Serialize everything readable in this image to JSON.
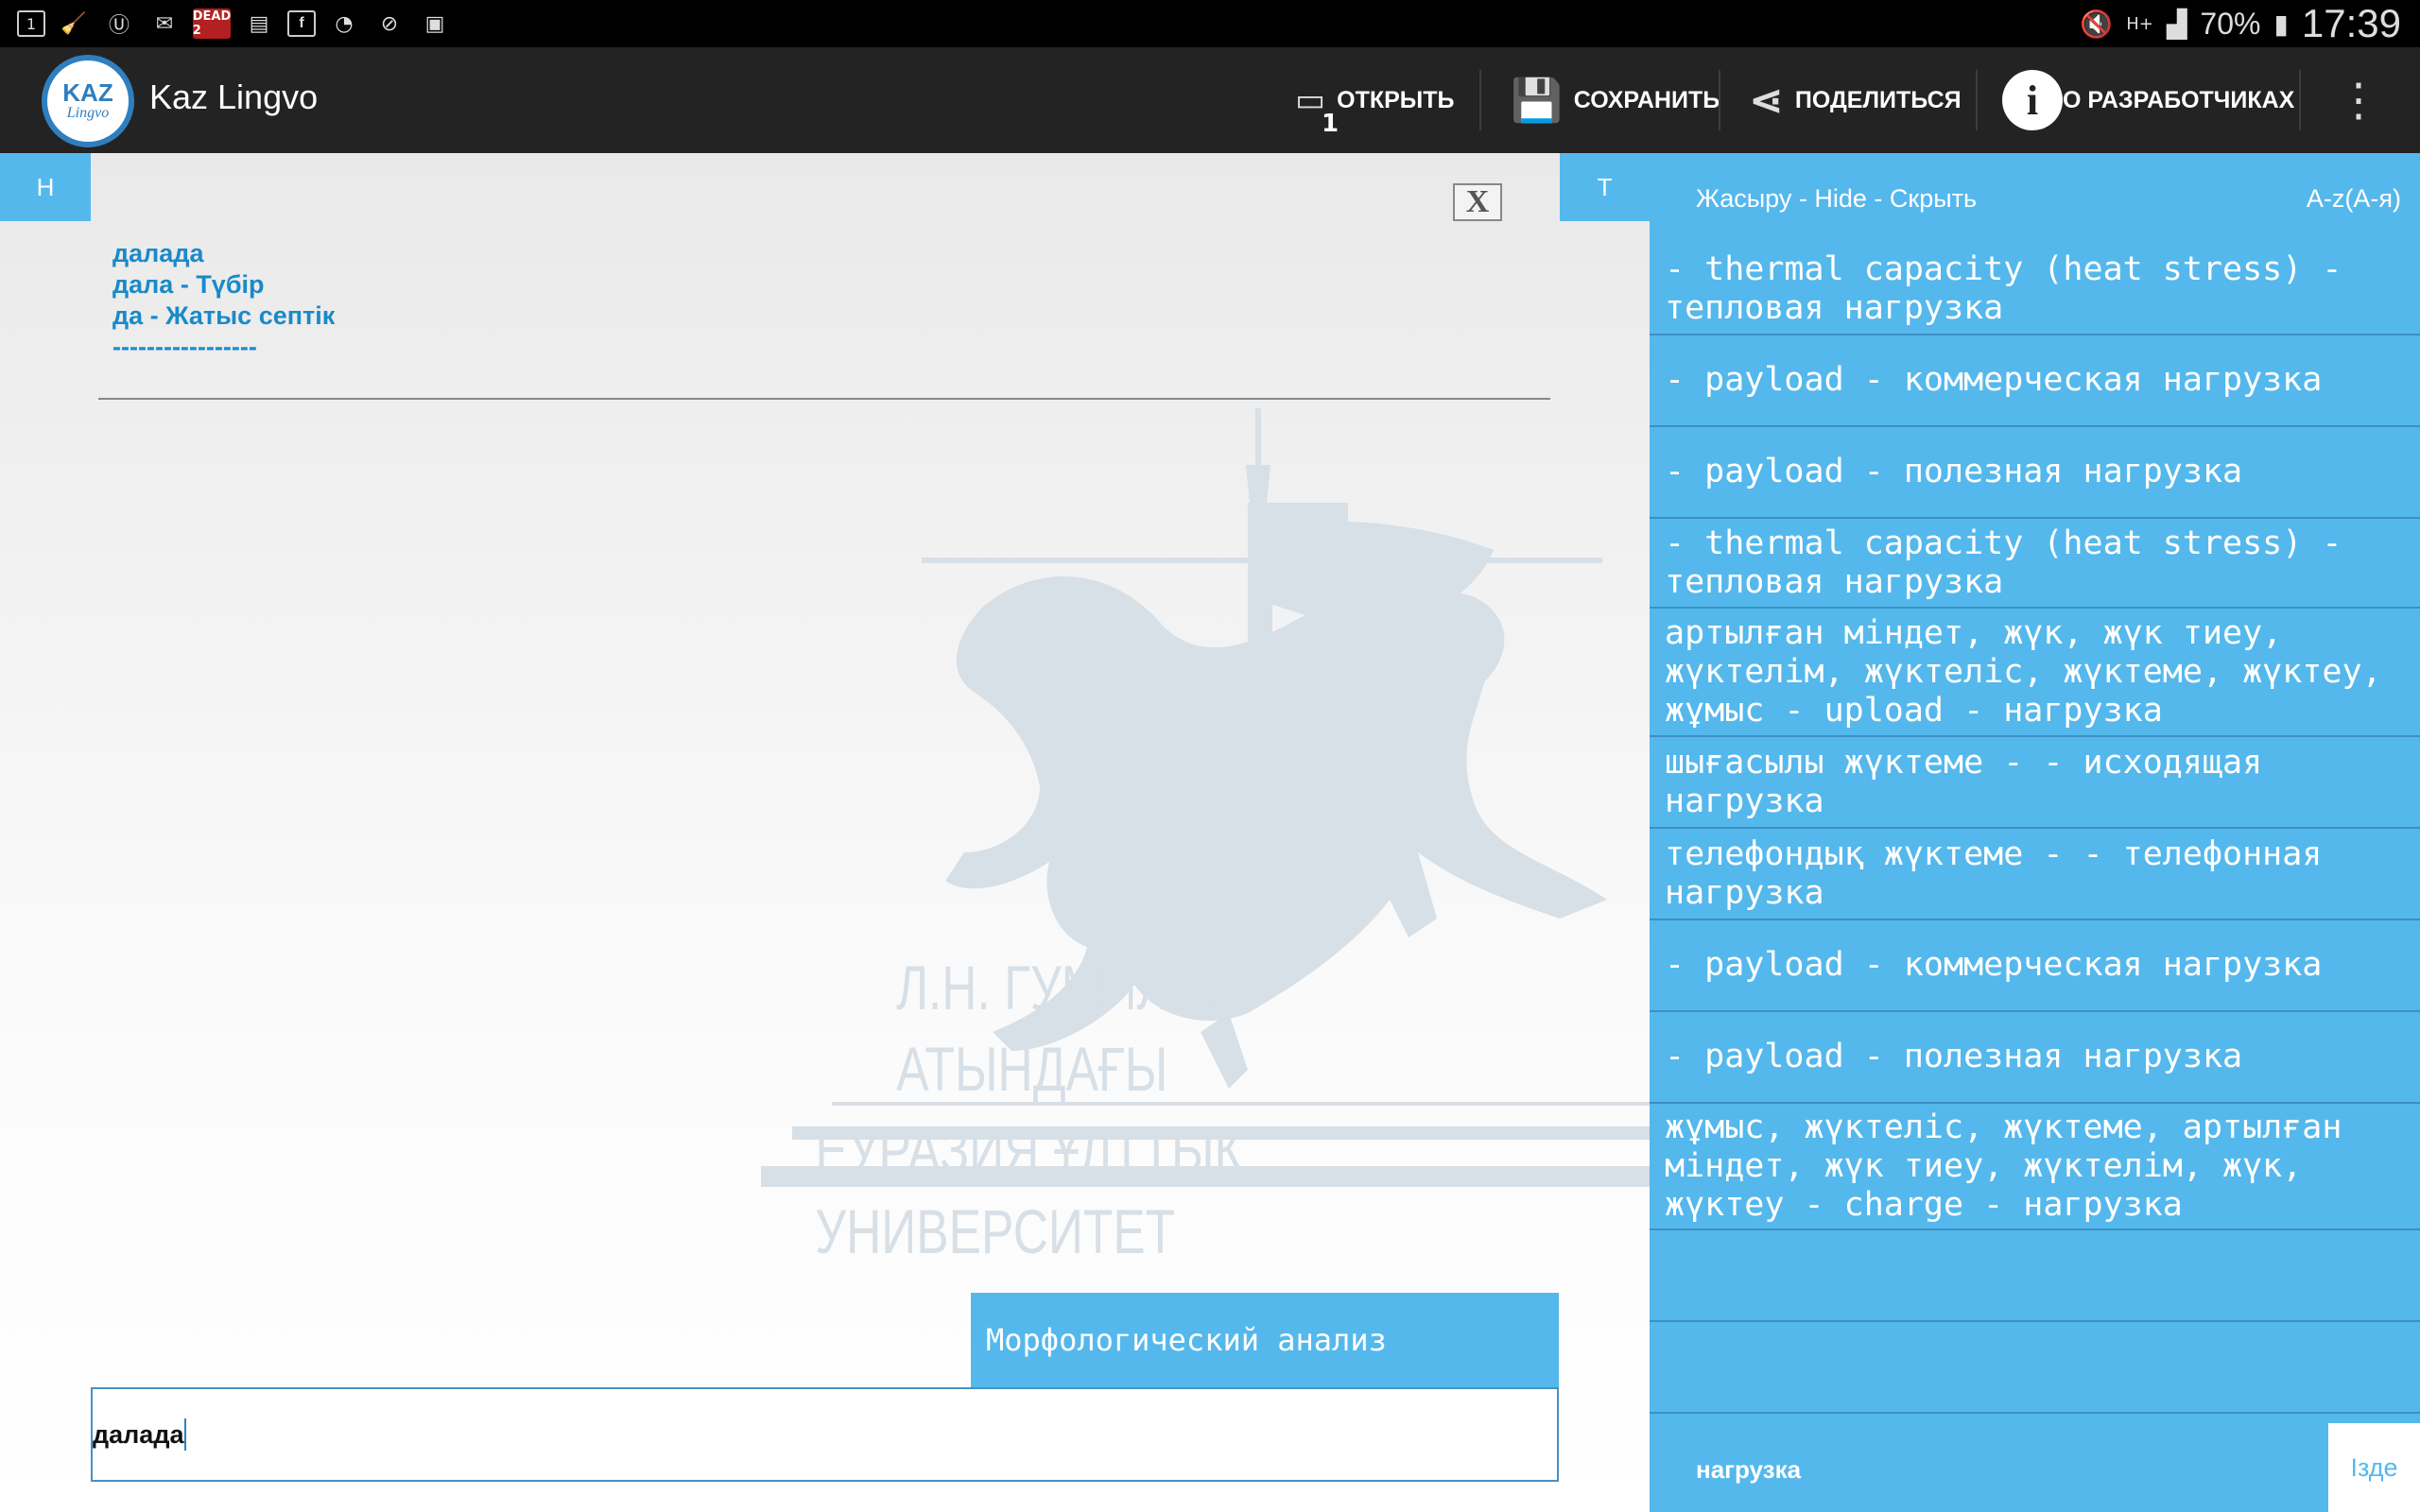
{
  "statusbar": {
    "left_icons": [
      "tab-count-icon",
      "brush-icon",
      "app-u-icon",
      "mail-icon",
      "game-badge-icon",
      "sdcard-icon",
      "facebook-icon",
      "wifi-icon",
      "compass-icon",
      "camera-icon"
    ],
    "tab_count": "1",
    "game_badge": "DEAD 2",
    "battery_pct": "70%",
    "time": "17:39",
    "network": "H+"
  },
  "app": {
    "title": "Kaz Lingvo",
    "logo_line1": "KAZ",
    "logo_line2": "Lingvo"
  },
  "toolbar": {
    "open_label": "ОТКРЫТЬ",
    "open_badge": "1",
    "save_label": "СОХРАНИТЬ",
    "share_label": "ПОДЕЛИТЬСЯ",
    "about_label": "О РАЗРАБОТЧИКАХ",
    "overflow": "⋮"
  },
  "left": {
    "tab_h": "Н",
    "tab_t": "Т",
    "close": "X",
    "result_lines": [
      "далада",
      "дала - Түбір",
      "да - Жатыс септік",
      "-----------------"
    ],
    "watermark_line1": "Л.Н. ГУМИЛЕВ АТЫНДАҒЫ",
    "watermark_line2": "ЕУРАЗИЯ ҰЛТТЫҚ УНИВЕРСИТЕТ",
    "morph_button": "Морфологический анализ",
    "input_value": "далада"
  },
  "right": {
    "hide_label": "Жасыру - Hide - Скрыть",
    "sort_label": "A-z(А-я)",
    "items": [
      "- thermal capacity (heat stress) - тепловая нагрузка",
      "- payload - коммерческая нагрузка",
      "- payload - полезная нагрузка",
      "- thermal capacity (heat stress) - тепловая нагрузка",
      "артылған міндет, жүк, жүк тиеу, жүктелім, жүктеліс, жүктеме, жүктеу, жұмыс - upload - нагрузка",
      "шығасылы жүктеме - - исходящая нагрузка",
      "телефондық жүктеме - - телефонная нагрузка",
      "- payload - коммерческая нагрузка",
      "- payload - полезная нагрузка",
      "жұмыс, жүктеліс, жүктеме, артылған міндет, жүк тиеу, жүктелім, жүк, жүктеу - charge - нагрузка",
      "",
      ""
    ],
    "search_query": "нагрузка",
    "search_button": "Ізде"
  }
}
